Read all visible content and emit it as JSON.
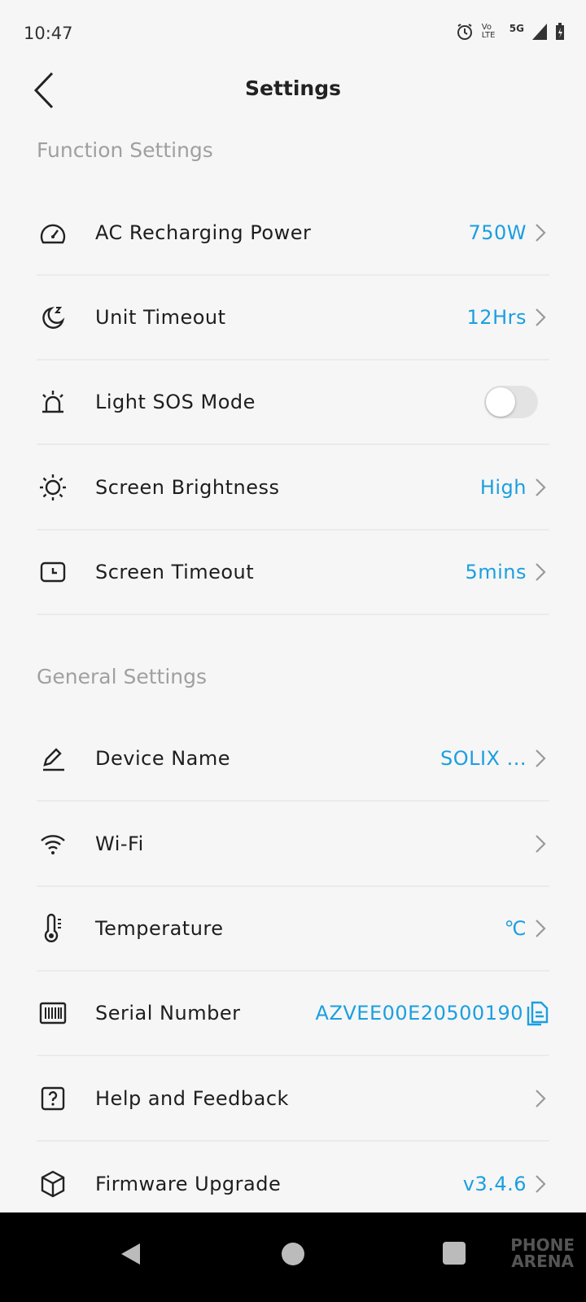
{
  "status_bar": {
    "time": "10:47",
    "icons": [
      "alarm-icon",
      "volte-icon",
      "5g-icon",
      "signal-icon",
      "battery-charging-icon"
    ],
    "network": "5G",
    "volte": "Vo LTE"
  },
  "header": {
    "title": "Settings"
  },
  "accent_color": "#1a9fe0",
  "function_settings": {
    "title": "Function Settings",
    "items": [
      {
        "label": "AC Recharging Power",
        "value": "750W",
        "icon": "speedometer-icon"
      },
      {
        "label": "Unit Timeout",
        "value": "12Hrs",
        "icon": "moon-sleep-icon"
      },
      {
        "label": "Light SOS Mode",
        "toggle": false,
        "icon": "alarm-light-icon"
      },
      {
        "label": "Screen Brightness",
        "value": "High",
        "icon": "sun-icon"
      },
      {
        "label": "Screen Timeout",
        "value": "5mins",
        "icon": "screen-clock-icon"
      }
    ]
  },
  "general_settings": {
    "title": "General Settings",
    "items": [
      {
        "label": "Device Name",
        "value": "SOLIX ...",
        "icon": "pencil-icon"
      },
      {
        "label": "Wi-Fi",
        "value": "",
        "icon": "wifi-icon"
      },
      {
        "label": "Temperature",
        "value": "℃",
        "icon": "thermometer-icon"
      },
      {
        "label": "Serial Number",
        "value": "AZVEE00E20500190",
        "icon": "barcode-icon"
      },
      {
        "label": "Help and Feedback",
        "value": "",
        "icon": "help-icon"
      },
      {
        "label": "Firmware Upgrade",
        "value": "v3.4.6",
        "icon": "cube-icon"
      }
    ]
  },
  "watermark": "PHONE ARENA"
}
